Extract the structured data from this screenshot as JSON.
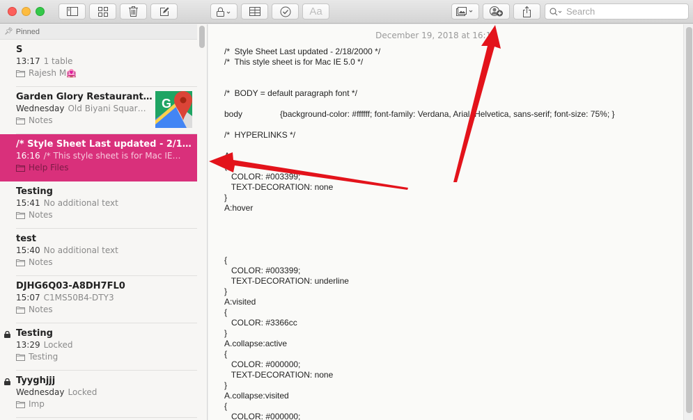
{
  "window": {
    "controls": [
      "close",
      "minimize",
      "zoom"
    ]
  },
  "toolbar": {
    "buttons": [
      {
        "name": "sidebar-toggle",
        "icon": "sidebar-icon"
      },
      {
        "name": "gallery-view",
        "icon": "grid-icon"
      },
      {
        "name": "delete",
        "icon": "trash-icon"
      },
      {
        "name": "new-note",
        "icon": "compose-icon"
      },
      {
        "name": "lock",
        "icon": "lock-icon"
      },
      {
        "name": "table",
        "icon": "table-icon"
      },
      {
        "name": "checklist",
        "icon": "checkmark-circle-icon"
      },
      {
        "name": "format",
        "icon": "text-format-icon",
        "label": "Aa"
      },
      {
        "name": "media",
        "icon": "photo-icon"
      },
      {
        "name": "add-people",
        "icon": "add-person-icon"
      },
      {
        "name": "share",
        "icon": "share-icon"
      }
    ],
    "search_placeholder": "Search"
  },
  "list": {
    "pinned_label": "Pinned",
    "notes": [
      {
        "title": "S",
        "time": "13:17",
        "preview": "1 table",
        "folder": "Rajesh M🏩",
        "locked": false,
        "selected": false
      },
      {
        "title": "Garden Glory Restaurant…",
        "time": "Wednesday",
        "preview": "Old Biyani Squar…",
        "folder": "Notes",
        "locked": false,
        "selected": false,
        "thumbnail": "google-maps-icon"
      },
      {
        "title": "/* Style Sheet Last updated - 2/1…",
        "time": "16:16",
        "preview": "/* This style sheet is for Mac IE…",
        "folder": "Help Files",
        "locked": false,
        "selected": true
      },
      {
        "title": "Testing",
        "time": "15:41",
        "preview": "No additional text",
        "folder": "Notes",
        "locked": false,
        "selected": false
      },
      {
        "title": "test",
        "time": "15:40",
        "preview": "No additional text",
        "folder": "Notes",
        "locked": false,
        "selected": false
      },
      {
        "title": "DJHG6Q03-A8DH7FL0",
        "time": "15:07",
        "preview": "C1MS50B4-DTY3",
        "folder": "Notes",
        "locked": false,
        "selected": false
      },
      {
        "title": "Testing",
        "time": "13:29",
        "preview": "Locked",
        "folder": "Testing",
        "locked": true,
        "selected": false
      },
      {
        "title": "Tyyghjjj",
        "time": "Wednesday",
        "preview": "Locked",
        "folder": "Imp",
        "locked": true,
        "selected": false
      }
    ]
  },
  "editor": {
    "date": "December 19, 2018 at 16:16",
    "lines": [
      "/*  Style Sheet Last updated - 2/18/2000 */",
      "/*  This style sheet is for Mac IE 5.0 */",
      "",
      "",
      "/*  BODY = default paragraph font */",
      "",
      "body\t\t{background-color: #ffffff; font-family: Verdana, Arial, Helvetica, sans-serif; font-size: 75%; }",
      "",
      "/*  HYPERLINKS */",
      "",
      "A",
      "{",
      "   COLOR: #003399;",
      "   TEXT-DECORATION: none",
      "}",
      "A:hover",
      "",
      "",
      "",
      "",
      "{",
      "   COLOR: #003399;",
      "   TEXT-DECORATION: underline",
      "}",
      "A:visited",
      "{",
      "   COLOR: #3366cc",
      "}",
      "A.collapse:active",
      "{",
      "   COLOR: #000000;",
      "   TEXT-DECORATION: none",
      "}",
      "A.collapse:visited",
      "{",
      "   COLOR: #000000;"
    ]
  },
  "annotations": {
    "arrow_color": "#e3131b",
    "arrows": [
      {
        "points_to": "add-people-button"
      },
      {
        "points_to": "selected-note"
      }
    ]
  },
  "colors": {
    "selected_note": "#d9307b"
  }
}
